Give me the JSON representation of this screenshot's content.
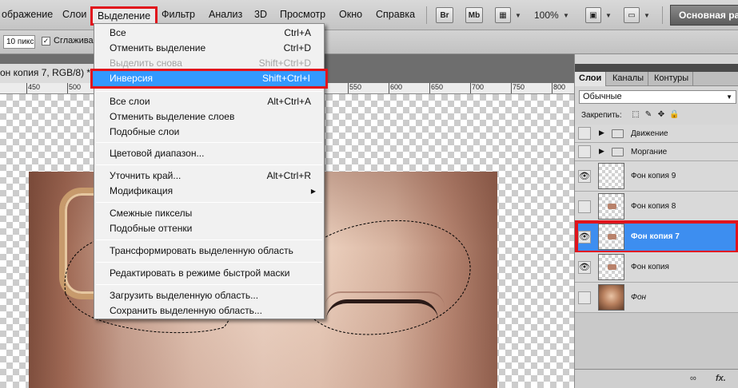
{
  "menubar": {
    "items": [
      "ображение",
      "Слои",
      "Выделение",
      "Фильтр",
      "Анализ",
      "3D",
      "Просмотр",
      "Окно",
      "Справка"
    ],
    "bridge": "Br",
    "minibridge": "Mb",
    "zoom": "100%",
    "workspace": "Основная ра"
  },
  "options": {
    "feather_value": "10 пикс",
    "antialias_label": "Сглаживан",
    "antialias_checked": "✓"
  },
  "document": {
    "tab_title": "он копия 7, RGB/8) *",
    "ruler_labels": [
      "450",
      "500",
      "500",
      "550",
      "600",
      "650",
      "700",
      "750",
      "800"
    ]
  },
  "menu": {
    "items": [
      {
        "label": "Все",
        "shortcut": "Ctrl+A"
      },
      {
        "label": "Отменить выделение",
        "shortcut": "Ctrl+D"
      },
      {
        "label": "Выделить снова",
        "shortcut": "Shift+Ctrl+D"
      },
      {
        "label": "Инверсия",
        "shortcut": "Shift+Ctrl+I"
      },
      {
        "label": "Все слои",
        "shortcut": "Alt+Ctrl+A"
      },
      {
        "label": "Отменить выделение слоев",
        "shortcut": ""
      },
      {
        "label": "Подобные слои",
        "shortcut": ""
      },
      {
        "label": "Цветовой диапазон...",
        "shortcut": ""
      },
      {
        "label": "Уточнить край...",
        "shortcut": "Alt+Ctrl+R"
      },
      {
        "label": "Модификация",
        "shortcut": ""
      },
      {
        "label": "Смежные пикселы",
        "shortcut": ""
      },
      {
        "label": "Подобные оттенки",
        "shortcut": ""
      },
      {
        "label": "Трансформировать выделенную область",
        "shortcut": ""
      },
      {
        "label": "Редактировать в режиме быстрой маски",
        "shortcut": ""
      },
      {
        "label": "Загрузить выделенную область...",
        "shortcut": ""
      },
      {
        "label": "Сохранить выделенную область...",
        "shortcut": ""
      }
    ]
  },
  "panel": {
    "tabs": [
      "Слои",
      "Каналы",
      "Контуры"
    ],
    "blend_mode": "Обычные",
    "lock_label": "Закрепить:",
    "layers": [
      {
        "name": "Движение"
      },
      {
        "name": "Моргание"
      },
      {
        "name": "Фон копия 9"
      },
      {
        "name": "Фон копия 8"
      },
      {
        "name": "Фон копия 7"
      },
      {
        "name": "Фон копия"
      },
      {
        "name": "Фон"
      }
    ],
    "bottom_link": "∞",
    "bottom_fx": "fx."
  },
  "colors": {
    "highlight_outline": "#e1141c",
    "menu_highlight": "#3399ff",
    "layer_selected": "#3d8ef0"
  }
}
